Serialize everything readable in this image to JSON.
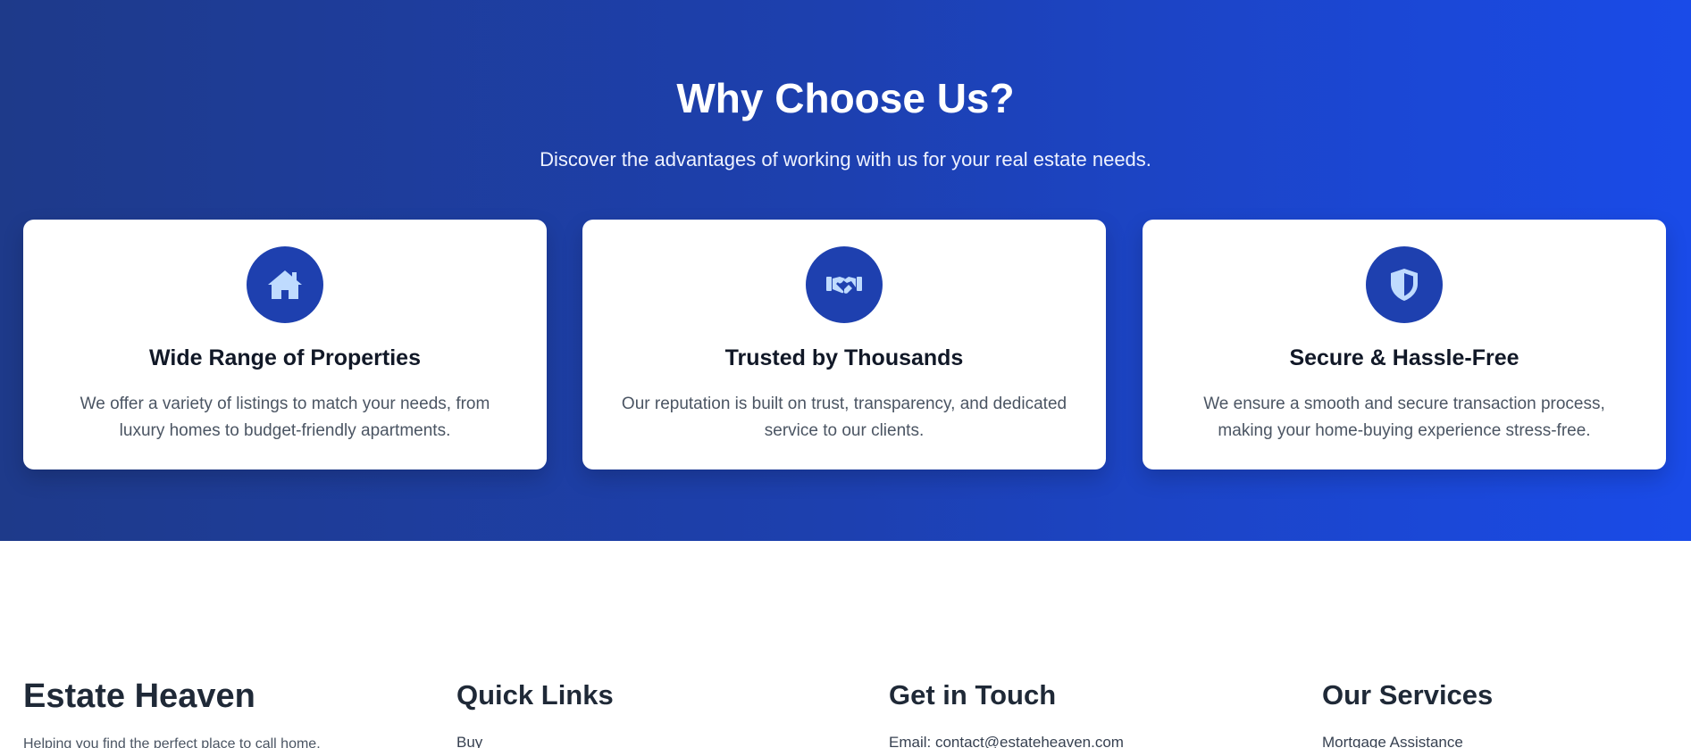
{
  "why_section": {
    "title": "Why Choose Us?",
    "subtitle": "Discover the advantages of working with us for your real estate needs.",
    "gradient_colors": [
      "#1e3a8a",
      "#1a4be8"
    ],
    "cards": [
      {
        "icon": "house-icon",
        "title": "Wide Range of Properties",
        "text": "We offer a variety of listings to match your needs, from luxury homes to budget-friendly apartments."
      },
      {
        "icon": "handshake-icon",
        "title": "Trusted by Thousands",
        "text": "Our reputation is built on trust, transparency, and dedicated service to our clients."
      },
      {
        "icon": "shield-icon",
        "title": "Secure & Hassle-Free",
        "text": "We ensure a smooth and secure transaction process, making your home-buying experience stress-free."
      }
    ]
  },
  "footer": {
    "brand": {
      "name": "Estate Heaven",
      "tagline": "Helping you find the perfect place to call home."
    },
    "quick_links": {
      "heading": "Quick Links",
      "items": [
        "Buy"
      ]
    },
    "contact": {
      "heading": "Get in Touch",
      "items": [
        "Email: contact@estateheaven.com"
      ]
    },
    "services": {
      "heading": "Our Services",
      "items": [
        "Mortgage Assistance"
      ]
    }
  },
  "colors": {
    "icon_circle": "#1e40af",
    "icon_glyph": "#bfdbfe",
    "card_title": "#111827",
    "card_text": "#4b5563"
  }
}
